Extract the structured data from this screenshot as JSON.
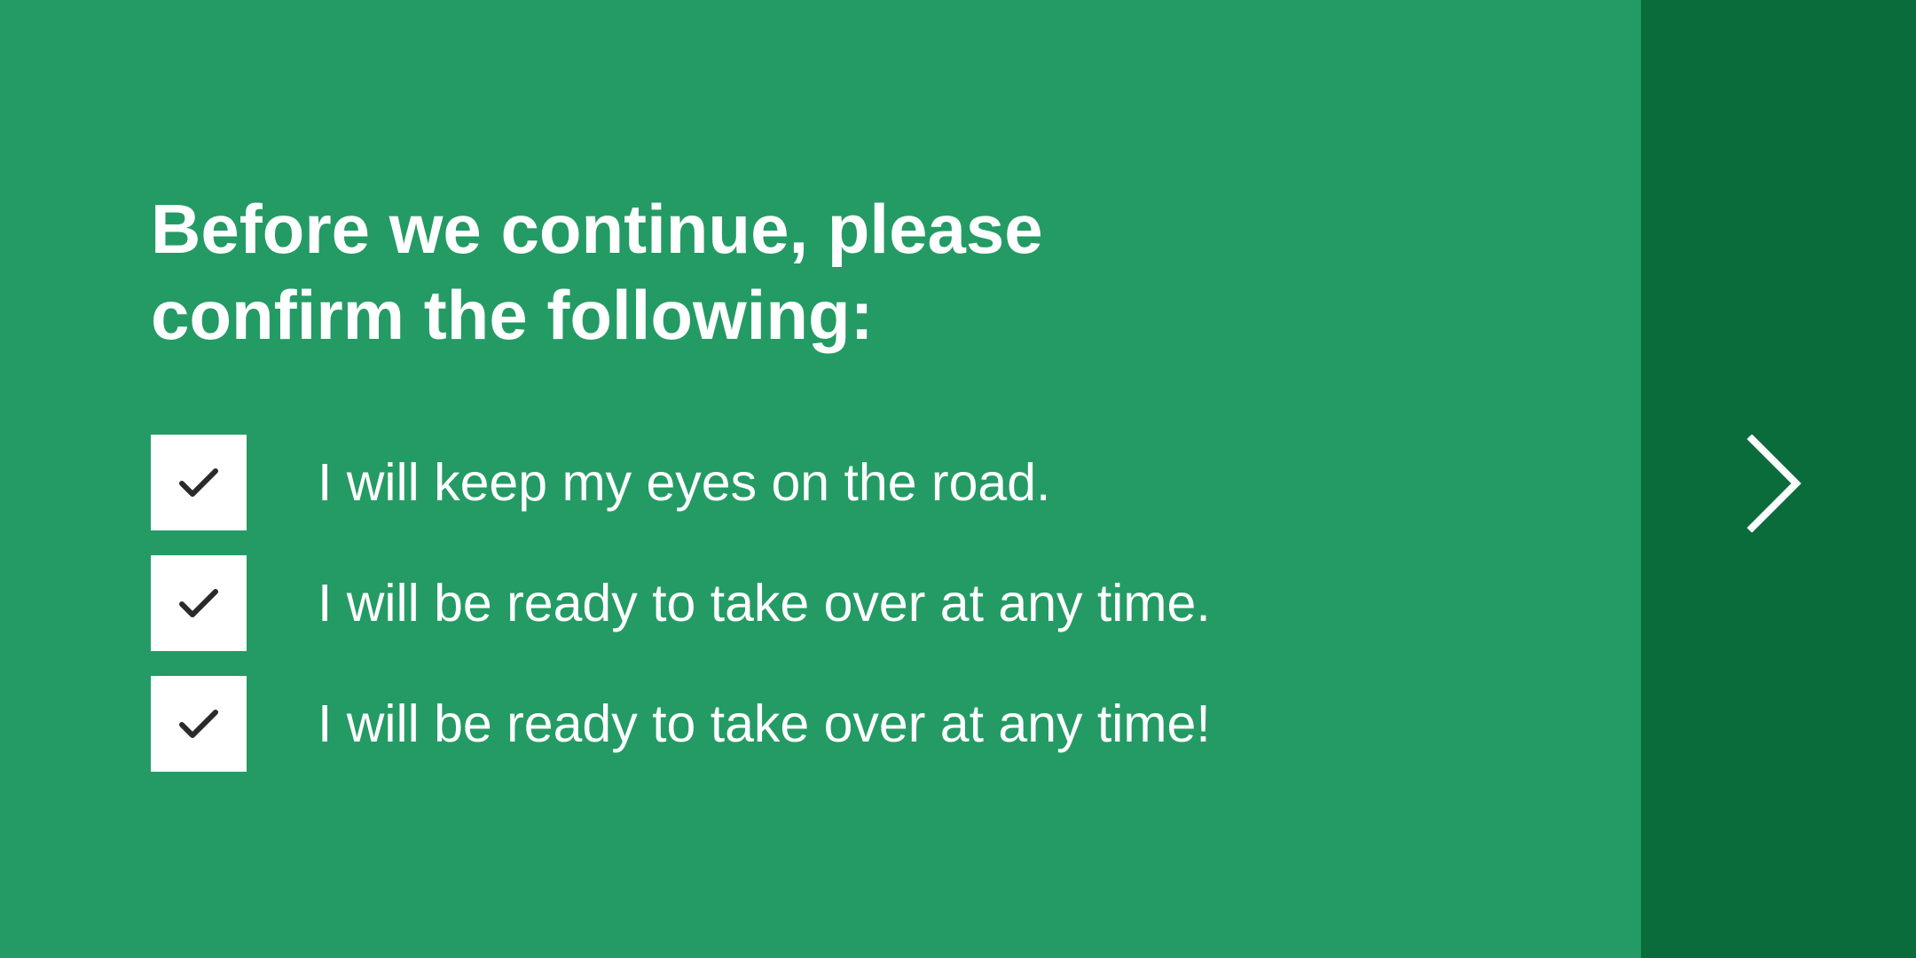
{
  "prompt": {
    "heading": "Before we continue, please confirm the following:"
  },
  "checklist": {
    "items": [
      {
        "label": "I will keep my eyes on the road.",
        "checked": true
      },
      {
        "label": "I will be ready to take over at any time.",
        "checked": true
      },
      {
        "label": "I will be ready to take over at any time!",
        "checked": true
      }
    ]
  },
  "navigation": {
    "next_icon": "chevron-right-icon"
  },
  "colors": {
    "main_background": "#249b64",
    "side_panel_background": "#0a6b3b",
    "text": "#ffffff",
    "checkbox_background": "#ffffff",
    "checkmark": "#2a2a2a"
  }
}
